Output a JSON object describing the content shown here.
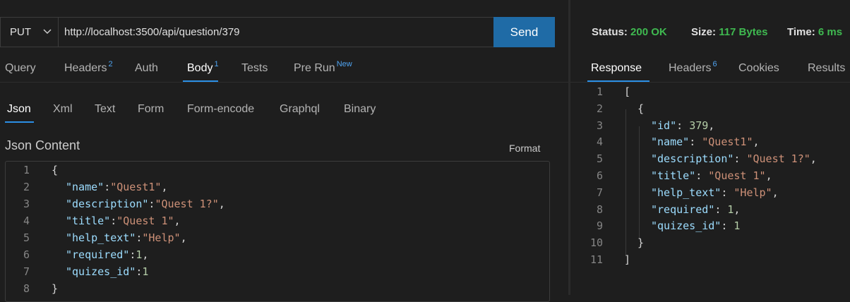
{
  "request": {
    "method": "PUT",
    "url": "http://localhost:3500/api/question/379",
    "send_label": "Send",
    "tabs": [
      {
        "label": "Query",
        "count": ""
      },
      {
        "label": "Headers",
        "count": "2"
      },
      {
        "label": "Auth",
        "count": ""
      },
      {
        "label": "Body",
        "count": "1"
      },
      {
        "label": "Tests",
        "count": ""
      },
      {
        "label": "Pre Run",
        "count": "New"
      }
    ],
    "active_tab": "Body",
    "body_tabs": [
      "Json",
      "Xml",
      "Text",
      "Form",
      "Form-encode",
      "Graphql",
      "Binary"
    ],
    "active_body_tab": "Json",
    "json_content_label": "Json Content",
    "format_label": "Format",
    "code_lines": [
      {
        "n": "1",
        "text": "{"
      },
      {
        "n": "2",
        "key": "\"name\"",
        "sep": ":",
        "val": "\"Quest1\"",
        "type": "str",
        "end": ","
      },
      {
        "n": "3",
        "key": "\"description\"",
        "sep": ":",
        "val": "\"Quest 1?\"",
        "type": "str",
        "end": ","
      },
      {
        "n": "4",
        "key": "\"title\"",
        "sep": ":",
        "val": "\"Quest 1\"",
        "type": "str",
        "end": ","
      },
      {
        "n": "5",
        "key": "\"help_text\"",
        "sep": ":",
        "val": "\"Help\"",
        "type": "str",
        "end": ","
      },
      {
        "n": "6",
        "key": "\"required\"",
        "sep": ":",
        "val": "1",
        "type": "num",
        "end": ","
      },
      {
        "n": "7",
        "key": "\"quizes_id\"",
        "sep": ":",
        "val": "1",
        "type": "num",
        "end": ""
      },
      {
        "n": "8",
        "text": "}"
      }
    ]
  },
  "response": {
    "status_label": "Status:",
    "status_value": "200 OK",
    "size_label": "Size:",
    "size_value": "117 Bytes",
    "time_label": "Time:",
    "time_value": "6 ms",
    "tabs": [
      {
        "label": "Response",
        "count": ""
      },
      {
        "label": "Headers",
        "count": "6"
      },
      {
        "label": "Cookies",
        "count": ""
      },
      {
        "label": "Results",
        "count": ""
      }
    ],
    "active_tab": "Response",
    "code_lines": [
      {
        "n": "1",
        "indent": 0,
        "text": "["
      },
      {
        "n": "2",
        "indent": 1,
        "text": "{"
      },
      {
        "n": "3",
        "indent": 2,
        "key": "\"id\"",
        "val": "379",
        "type": "num",
        "end": ","
      },
      {
        "n": "4",
        "indent": 2,
        "key": "\"name\"",
        "val": "\"Quest1\"",
        "type": "str",
        "end": ","
      },
      {
        "n": "5",
        "indent": 2,
        "key": "\"description\"",
        "val": "\"Quest 1?\"",
        "type": "str",
        "end": ","
      },
      {
        "n": "6",
        "indent": 2,
        "key": "\"title\"",
        "val": "\"Quest 1\"",
        "type": "str",
        "end": ","
      },
      {
        "n": "7",
        "indent": 2,
        "key": "\"help_text\"",
        "val": "\"Help\"",
        "type": "str",
        "end": ","
      },
      {
        "n": "8",
        "indent": 2,
        "key": "\"required\"",
        "val": "1",
        "type": "num",
        "end": ","
      },
      {
        "n": "9",
        "indent": 2,
        "key": "\"quizes_id\"",
        "val": "1",
        "type": "num",
        "end": ""
      },
      {
        "n": "10",
        "indent": 1,
        "text": "}"
      },
      {
        "n": "11",
        "indent": 0,
        "text": "]"
      }
    ]
  },
  "colors": {
    "accent": "#2b8fe6",
    "send_button": "#1f6ba6",
    "status_ok": "#3fb950",
    "json_key": "#9cdcfe",
    "json_string": "#ce9178",
    "json_number": "#b5cea8"
  },
  "icons": {
    "method_dropdown": "chevron-down-icon"
  }
}
